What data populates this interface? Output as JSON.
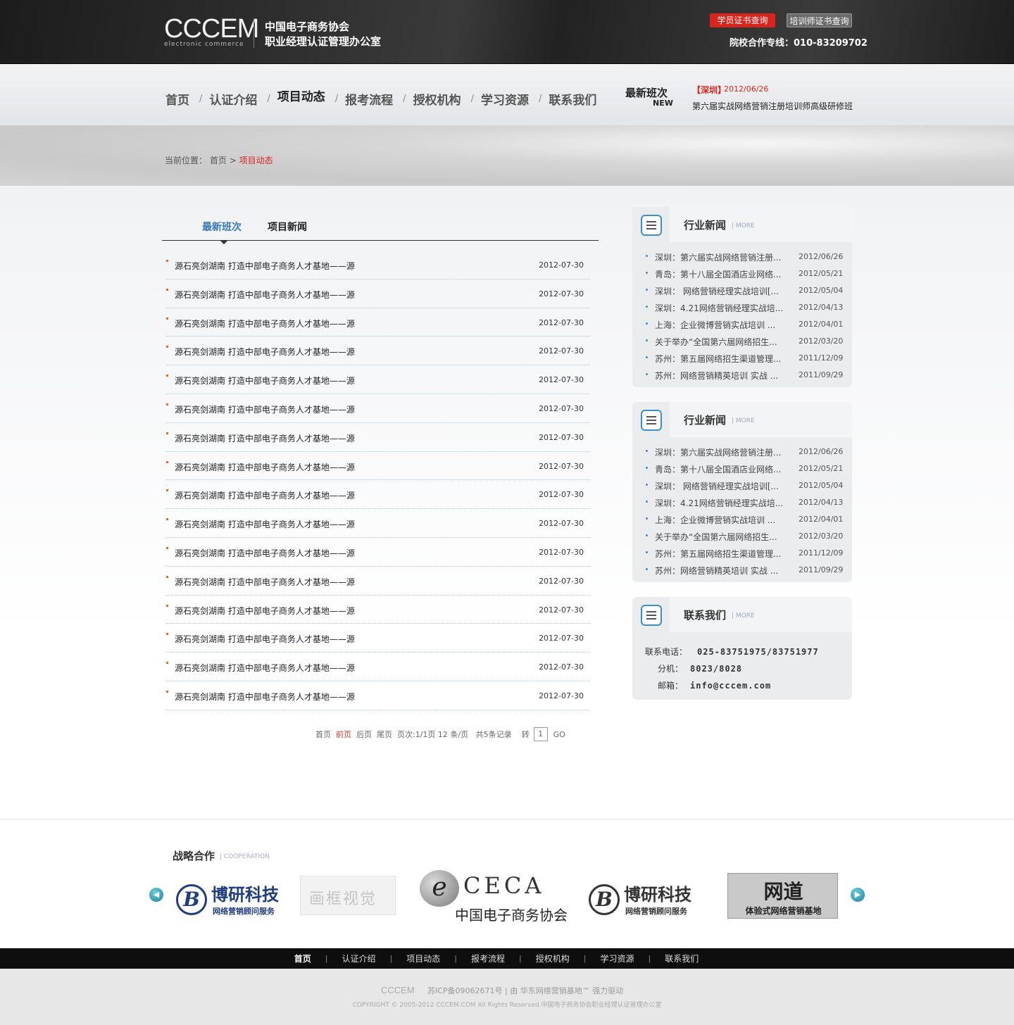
{
  "header": {
    "logo_main": "CCCEM",
    "logo_sub": "electronic commerce",
    "org_line1": "中国电子商务协会",
    "org_line2": "职业经理认证管理办公室",
    "btn_student": "学员证书查询",
    "btn_trainer": "培训师证书查询",
    "hotline": "院校合作专线：010-83209702"
  },
  "nav": {
    "items": [
      "首页",
      "认证介绍",
      "项目动态",
      "报考流程",
      "授权机构",
      "学习资源",
      "联系我们"
    ],
    "active_index": 2,
    "separator": "/"
  },
  "latest": {
    "title": "最新班次",
    "badge": "NEW",
    "city": "【深圳】",
    "date": "2012/06/26",
    "text": "第六届实战网络营销注册培训师高级研修班"
  },
  "breadcrumb": {
    "label": "当前位置：",
    "home": "首页",
    "arrow": ">",
    "current": "项目动态"
  },
  "main": {
    "tabs": [
      "最新班次",
      "项目新闻"
    ],
    "active_tab": 0,
    "rows": [
      {
        "title": "源石亮剑湖南  打造中部电子商务人才基地——源",
        "date": "2012-07-30"
      },
      {
        "title": "源石亮剑湖南  打造中部电子商务人才基地——源",
        "date": "2012-07-30"
      },
      {
        "title": "源石亮剑湖南  打造中部电子商务人才基地——源",
        "date": "2012-07-30"
      },
      {
        "title": "源石亮剑湖南  打造中部电子商务人才基地——源",
        "date": "2012-07-30"
      },
      {
        "title": "源石亮剑湖南  打造中部电子商务人才基地——源",
        "date": "2012-07-30"
      },
      {
        "title": "源石亮剑湖南  打造中部电子商务人才基地——源",
        "date": "2012-07-30"
      },
      {
        "title": "源石亮剑湖南  打造中部电子商务人才基地——源",
        "date": "2012-07-30"
      },
      {
        "title": "源石亮剑湖南  打造中部电子商务人才基地——源",
        "date": "2012-07-30"
      },
      {
        "title": "源石亮剑湖南  打造中部电子商务人才基地——源",
        "date": "2012-07-30"
      },
      {
        "title": "源石亮剑湖南  打造中部电子商务人才基地——源",
        "date": "2012-07-30"
      },
      {
        "title": "源石亮剑湖南  打造中部电子商务人才基地——源",
        "date": "2012-07-30"
      },
      {
        "title": "源石亮剑湖南  打造中部电子商务人才基地——源",
        "date": "2012-07-30"
      },
      {
        "title": "源石亮剑湖南  打造中部电子商务人才基地——源",
        "date": "2012-07-30"
      },
      {
        "title": "源石亮剑湖南  打造中部电子商务人才基地——源",
        "date": "2012-07-30"
      },
      {
        "title": "源石亮剑湖南  打造中部电子商务人才基地——源",
        "date": "2012-07-30"
      },
      {
        "title": "源石亮剑湖南  打造中部电子商务人才基地——源",
        "date": "2012-07-30"
      }
    ],
    "pager": {
      "first": "首页",
      "prev": "前页",
      "next": "后页",
      "last": "尾页",
      "info": "页次:1/1页 12 条/页",
      "total": "共5条记录",
      "goto": "转",
      "input_value": "1",
      "go": "GO"
    }
  },
  "sidebar": {
    "more": "MORE",
    "boxes": [
      {
        "title": "行业新闻",
        "items": [
          {
            "text": "深圳：第六届实战网络营销注册...",
            "date": "2012/06/26"
          },
          {
            "text": "青岛：第十八届全国酒店业网络...",
            "date": "2012/05/21"
          },
          {
            "text": "深圳：  网络营销经理实战培训[...",
            "date": "2012/05/04"
          },
          {
            "text": "深圳：4.21网络营销经理实战培...",
            "date": "2012/04/13"
          },
          {
            "text": "上海：企业微博营销实战培训   ...",
            "date": "2012/04/01"
          },
          {
            "text": "关于举办“全国第六届网络招生...",
            "date": "2012/03/20"
          },
          {
            "text": "苏州：第五届网络招生渠道管理...",
            "date": "2011/12/09"
          },
          {
            "text": "苏州：网络营销精英培训 实战 ...",
            "date": "2011/09/29"
          }
        ]
      },
      {
        "title": "行业新闻",
        "items": [
          {
            "text": "深圳：第六届实战网络营销注册...",
            "date": "2012/06/26"
          },
          {
            "text": "青岛：第十八届全国酒店业网络...",
            "date": "2012/05/21"
          },
          {
            "text": "深圳：  网络营销经理实战培训[...",
            "date": "2012/05/04"
          },
          {
            "text": "深圳：4.21网络营销经理实战培...",
            "date": "2012/04/13"
          },
          {
            "text": "上海：企业微博营销实战培训   ...",
            "date": "2012/04/01"
          },
          {
            "text": "关于举办“全国第六届网络招生...",
            "date": "2012/03/20"
          },
          {
            "text": "苏州：第五届网络招生渠道管理...",
            "date": "2011/12/09"
          },
          {
            "text": "苏州：网络营销精英培训 实战 ...",
            "date": "2011/09/29"
          }
        ]
      }
    ],
    "contact": {
      "title": "联系我们",
      "phone_label": "联系电话：",
      "phone": "025-83751975/83751977",
      "ext_label": "分机：",
      "ext": "8023/8028",
      "email_label": "邮箱：",
      "email": "info@cccem.com"
    }
  },
  "partners": {
    "title": "战略合作",
    "subtitle": "COOPERATION",
    "logos": [
      {
        "mark": "B",
        "name": "博研科技",
        "sub": "网络营销顾问服务"
      },
      {
        "name": "画框视觉"
      },
      {
        "mark": "e",
        "name": "CECA",
        "sub": "中国电子商务协会"
      },
      {
        "mark": "B",
        "name": "博研科技",
        "sub": "网络营销顾问服务"
      },
      {
        "name": "网道",
        "sub": "体验式网络营销基地"
      }
    ]
  },
  "footer": {
    "nav": [
      "首页",
      "认证介绍",
      "项目动态",
      "报考流程",
      "授权机构",
      "学习资源",
      "联系我们"
    ],
    "logo": "CCCEM",
    "icp": "苏ICP备09062671号 | 由 华东网络营销基地™ 强力驱动",
    "copyright": "COPYRIGHT © 2005-2012 CCCEM.COM All Rights Reserved.中国电子商务协会职业经理认证管理办公室"
  },
  "colors": {
    "accent_red": "#d8241c",
    "accent_blue": "#3a78b6",
    "bullet_orange": "#e46b1f"
  }
}
